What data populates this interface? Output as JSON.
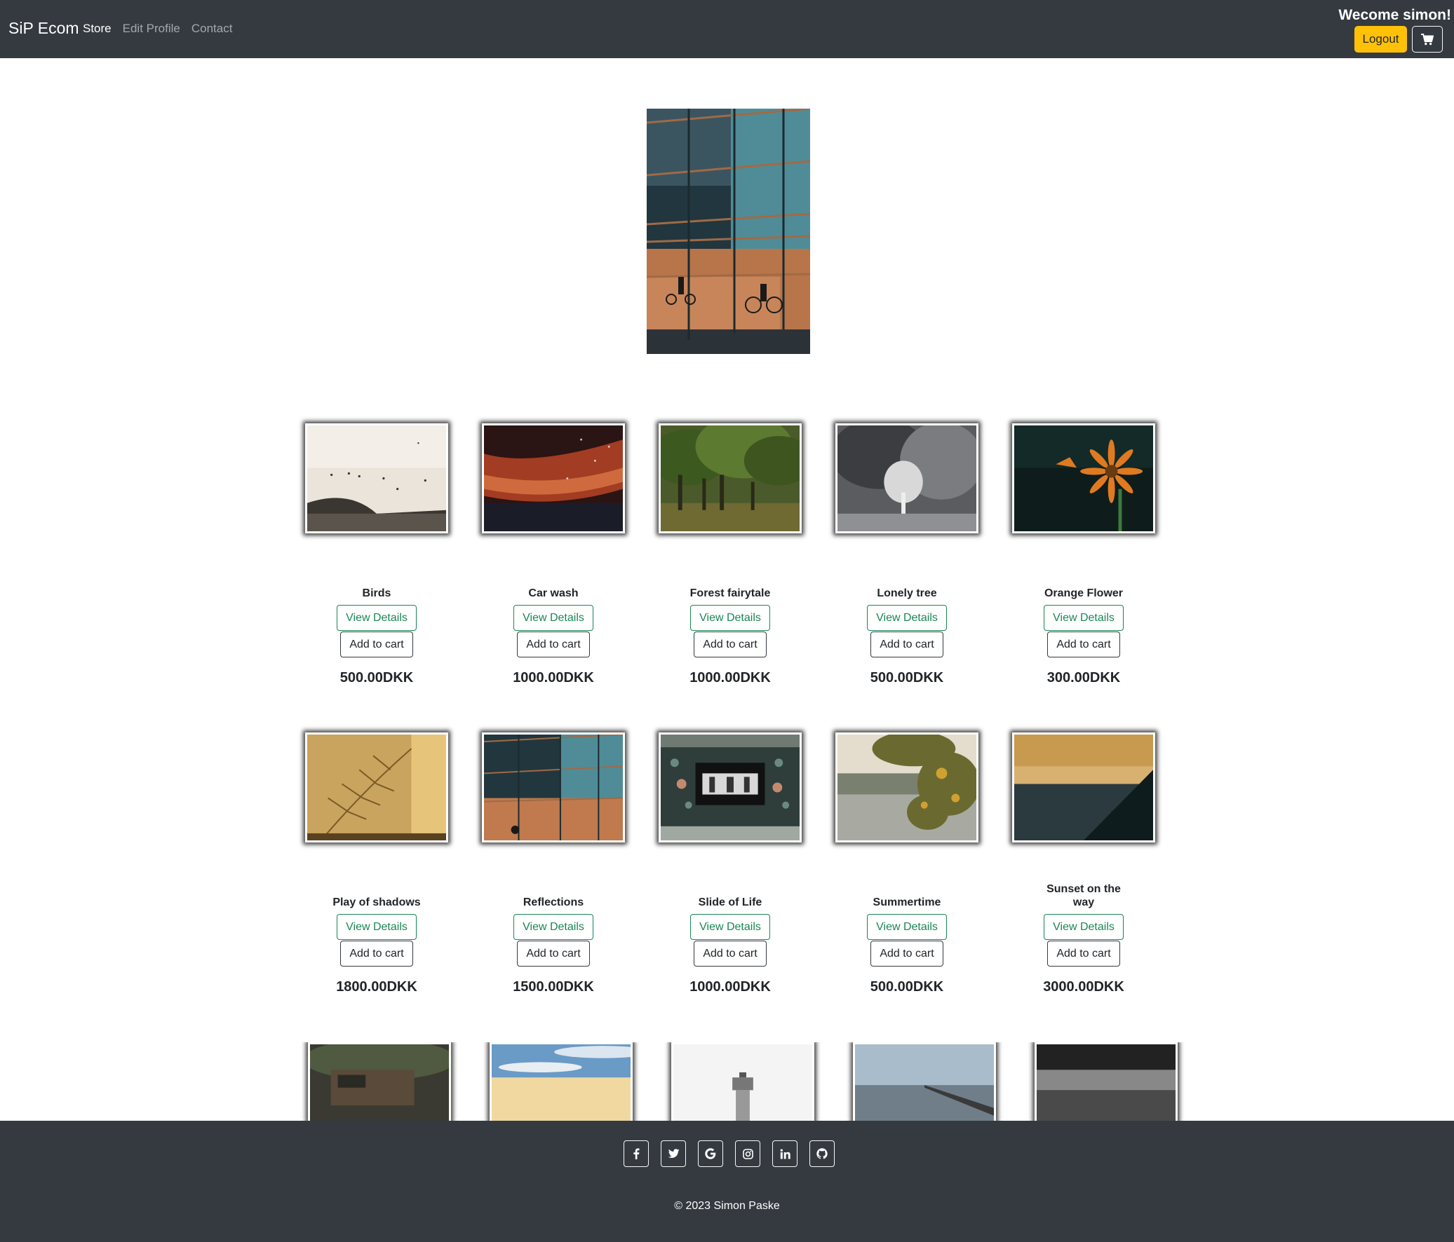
{
  "navbar": {
    "brand": "SiP Ecom",
    "links": [
      {
        "label": "Store",
        "active": true
      },
      {
        "label": "Edit Profile",
        "active": false
      },
      {
        "label": "Contact",
        "active": false
      }
    ],
    "welcome": "Wecome simon!",
    "logout_label": "Logout",
    "cart_icon": "shopping-cart-icon"
  },
  "products": [
    {
      "name": "Birds",
      "view_label": "View Details",
      "cart_label": "Add to cart",
      "price": "500.00DKK"
    },
    {
      "name": "Car wash",
      "view_label": "View Details",
      "cart_label": "Add to cart",
      "price": "1000.00DKK"
    },
    {
      "name": "Forest fairytale",
      "view_label": "View Details",
      "cart_label": "Add to cart",
      "price": "1000.00DKK"
    },
    {
      "name": "Lonely tree",
      "view_label": "View Details",
      "cart_label": "Add to cart",
      "price": "500.00DKK"
    },
    {
      "name": "Orange Flower",
      "view_label": "View Details",
      "cart_label": "Add to cart",
      "price": "300.00DKK"
    },
    {
      "name": "Play of shadows",
      "view_label": "View Details",
      "cart_label": "Add to cart",
      "price": "1800.00DKK"
    },
    {
      "name": "Reflections",
      "view_label": "View Details",
      "cart_label": "Add to cart",
      "price": "1500.00DKK"
    },
    {
      "name": "Slide of Life",
      "view_label": "View Details",
      "cart_label": "Add to cart",
      "price": "1000.00DKK"
    },
    {
      "name": "Summertime",
      "view_label": "View Details",
      "cart_label": "Add to cart",
      "price": "500.00DKK"
    },
    {
      "name": "Sunset on the way",
      "view_label": "View Details",
      "cart_label": "Add to cart",
      "price": "3000.00DKK"
    }
  ],
  "footer": {
    "social_icons": [
      "facebook-icon",
      "twitter-icon",
      "google-icon",
      "instagram-icon",
      "linkedin-icon",
      "github-icon"
    ],
    "copyright": "© 2023 Simon Paske"
  },
  "colors": {
    "navbar_bg": "#343a40",
    "logout_bg": "#ffc107",
    "view_details": "#198754"
  }
}
